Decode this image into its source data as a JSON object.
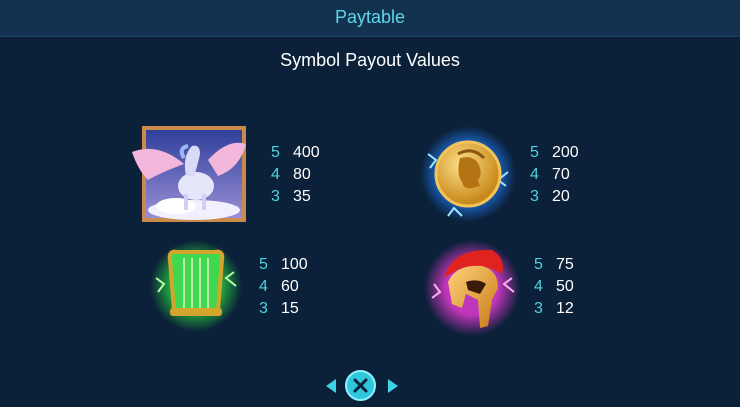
{
  "header": {
    "title": "Paytable"
  },
  "section": {
    "title": "Symbol Payout Values"
  },
  "symbols": [
    {
      "icon": "pegasus-icon",
      "payouts": [
        {
          "count": "5",
          "amount": "400"
        },
        {
          "count": "4",
          "amount": "80"
        },
        {
          "count": "3",
          "amount": "35"
        }
      ]
    },
    {
      "icon": "gold-coin-icon",
      "payouts": [
        {
          "count": "5",
          "amount": "200"
        },
        {
          "count": "4",
          "amount": "70"
        },
        {
          "count": "3",
          "amount": "20"
        }
      ]
    },
    {
      "icon": "lyre-icon",
      "payouts": [
        {
          "count": "5",
          "amount": "100"
        },
        {
          "count": "4",
          "amount": "60"
        },
        {
          "count": "3",
          "amount": "15"
        }
      ]
    },
    {
      "icon": "spartan-helmet-icon",
      "payouts": [
        {
          "count": "5",
          "amount": "75"
        },
        {
          "count": "4",
          "amount": "50"
        },
        {
          "count": "3",
          "amount": "12"
        }
      ]
    }
  ],
  "navigation": {
    "prev_icon": "chevron-left-icon",
    "close_icon": "close-icon",
    "next_icon": "chevron-right-icon"
  },
  "colors": {
    "background": "#0b2039",
    "header": "#123250",
    "accent": "#4fd3e3",
    "text": "#ffffff"
  }
}
